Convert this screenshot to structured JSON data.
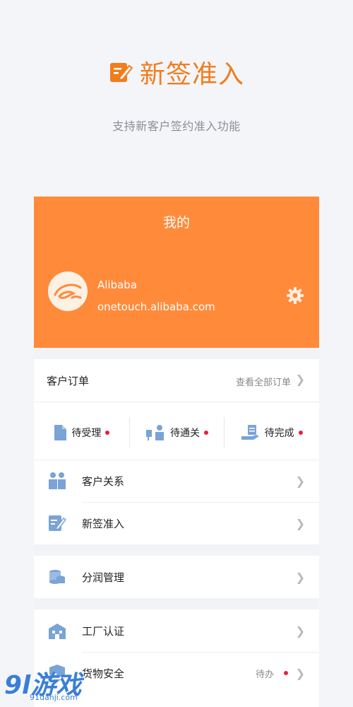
{
  "hero": {
    "title": "新签准入",
    "subtitle": "支持新客户签约准入功能"
  },
  "profile": {
    "title": "我的",
    "name": "Alibaba",
    "email": "onetouch.alibaba.com"
  },
  "orders": {
    "title": "客户订单",
    "view_all": "查看全部订单",
    "statuses": [
      {
        "label": "待受理"
      },
      {
        "label": "待通关"
      },
      {
        "label": "待完成"
      }
    ]
  },
  "menu1": [
    {
      "label": "客户关系"
    },
    {
      "label": "新签准入"
    }
  ],
  "menu2": [
    {
      "label": "分润管理"
    }
  ],
  "menu3": [
    {
      "label": "工厂认证"
    },
    {
      "label": "货物安全",
      "badge": "待办"
    }
  ],
  "watermark": {
    "brand": "9l游戏",
    "site": "91danji.com"
  },
  "colors": {
    "accent": "#f07d1e",
    "header": "#ff8a3a",
    "icon": "#7aa3d6",
    "dot": "#e8203a"
  }
}
